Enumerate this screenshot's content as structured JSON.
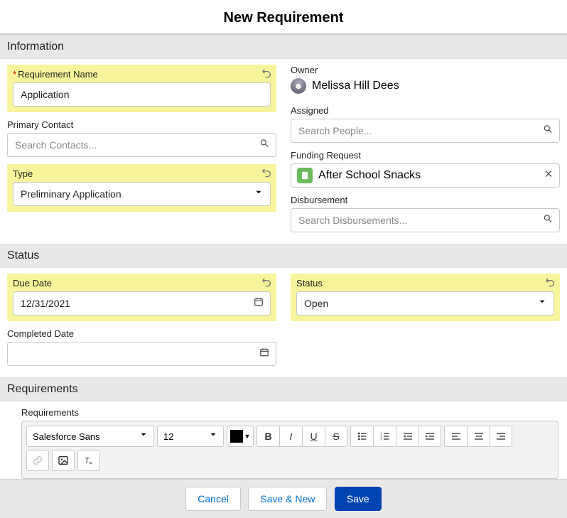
{
  "title": "New Requirement",
  "sections": {
    "information": "Information",
    "status": "Status",
    "requirements": "Requirements"
  },
  "info": {
    "requirement_name": {
      "label": "Requirement Name",
      "value": "Application",
      "required": true
    },
    "primary_contact": {
      "label": "Primary Contact",
      "placeholder": "Search Contacts..."
    },
    "type": {
      "label": "Type",
      "value": "Preliminary Application"
    },
    "owner": {
      "label": "Owner",
      "name": "Melissa Hill Dees"
    },
    "assigned": {
      "label": "Assigned",
      "placeholder": "Search People..."
    },
    "funding_request": {
      "label": "Funding Request",
      "value": "After School Snacks"
    },
    "disbursement": {
      "label": "Disbursement",
      "placeholder": "Search Disbursements..."
    }
  },
  "status": {
    "due_date": {
      "label": "Due Date",
      "value": "12/31/2021"
    },
    "completed_date": {
      "label": "Completed Date",
      "value": ""
    },
    "status": {
      "label": "Status",
      "value": "Open"
    }
  },
  "requirements": {
    "label": "Requirements",
    "rte": {
      "font": "Salesforce Sans",
      "size": "12"
    }
  },
  "footer": {
    "cancel": "Cancel",
    "save_new": "Save & New",
    "save": "Save"
  }
}
